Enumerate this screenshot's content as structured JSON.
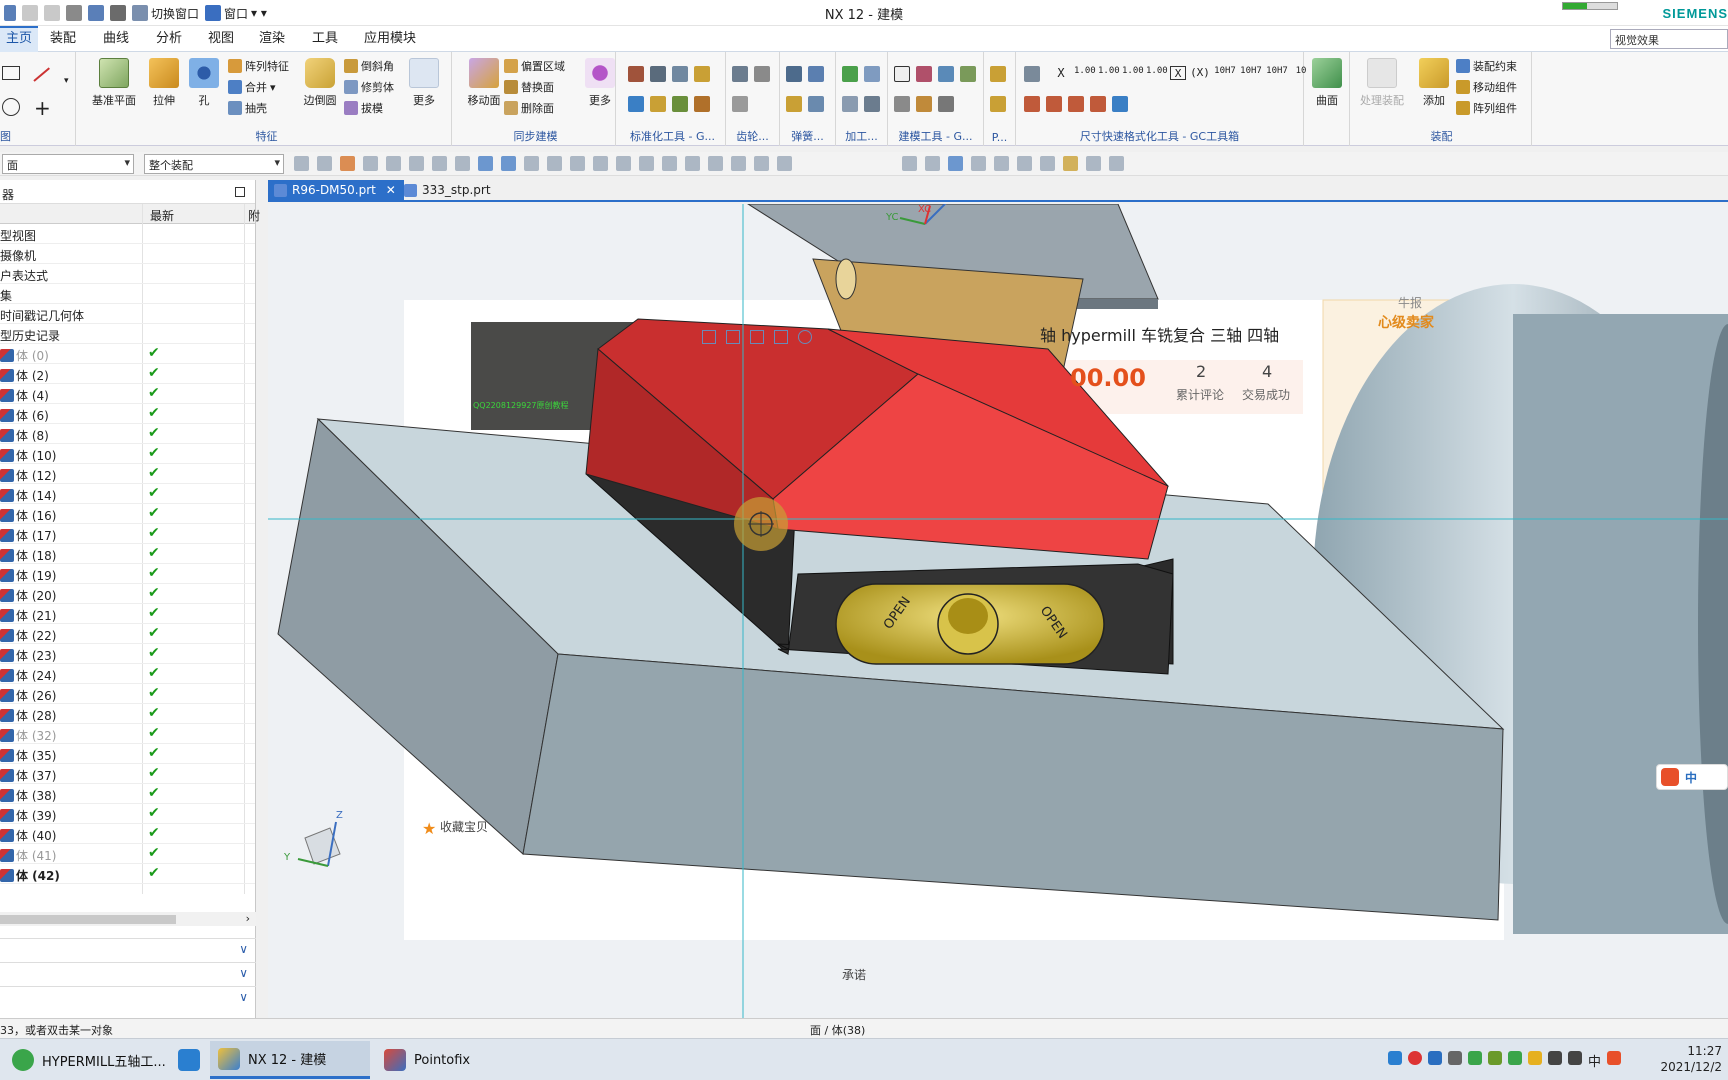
{
  "window": {
    "title": "NX 12 - 建模",
    "brand": "SIEMENS",
    "progress": 0.45
  },
  "quick_access": {
    "switch_window": "切换窗口",
    "window_menu": "窗口"
  },
  "menu": {
    "tabs": [
      "主页",
      "装配",
      "曲线",
      "分析",
      "视图",
      "渲染",
      "工具",
      "应用模块"
    ],
    "active_index": 0,
    "search_value": "视觉效果"
  },
  "ribbon": {
    "sketch_group_title": "图",
    "feature": {
      "title": "特征",
      "datum_plane": "基准平面",
      "extrude": "拉伸",
      "hole": "孔",
      "pattern_feature": "阵列特征",
      "unite": "合并",
      "shell": "抽壳",
      "edge_blend": "边倒圆",
      "chamfer": "倒斜角",
      "trim_body": "修剪体",
      "draft": "拔模",
      "more": "更多"
    },
    "sync": {
      "title": "同步建模",
      "move_face": "移动面",
      "offset_region": "偏置区域",
      "replace_face": "替换面",
      "delete_face": "删除面",
      "more": "更多"
    },
    "gc": {
      "standard_tools": "标准化工具 - G...",
      "gear": "齿轮...",
      "spring": "弹簧...",
      "machining": "加工...",
      "modeling_tools": "建模工具 - G...",
      "p": "P...",
      "dimension_tools": "尺寸快速格式化工具 - GC工具箱"
    },
    "dimension_labels": [
      "X",
      "1.00",
      "1.00",
      "1.00",
      "1.00",
      "(X)",
      "10H7",
      "10H7",
      "10H7",
      "10"
    ],
    "surface": {
      "label": "曲面"
    },
    "assembly": {
      "title": "装配",
      "process_assembly": "处理装配",
      "add": "添加",
      "constraint": "装配约束",
      "move_component": "移动组件",
      "pattern_component": "阵列组件"
    }
  },
  "filter_bar": {
    "type_filter": "面",
    "scope_filter": "整个装配"
  },
  "navigator": {
    "title": "器",
    "col_name": "",
    "col_latest": "最新",
    "col_extra": "附",
    "nodes": [
      {
        "label": "型视图",
        "check": "",
        "state": ""
      },
      {
        "label": "摄像机",
        "check": "",
        "state": ""
      },
      {
        "label": "户表达式",
        "check": "",
        "state": ""
      },
      {
        "label": "集",
        "check": "",
        "state": ""
      },
      {
        "label": "时间戳记几何体",
        "check": "",
        "state": ""
      },
      {
        "label": "型历史记录",
        "check": "",
        "state": ""
      },
      {
        "label": "体 (0)",
        "check": "✔",
        "state": "dim"
      },
      {
        "label": "体 (2)",
        "check": "✔",
        "state": ""
      },
      {
        "label": "体 (4)",
        "check": "✔",
        "state": ""
      },
      {
        "label": "体 (6)",
        "check": "✔",
        "state": ""
      },
      {
        "label": "体 (8)",
        "check": "✔",
        "state": ""
      },
      {
        "label": "体 (10)",
        "check": "✔",
        "state": ""
      },
      {
        "label": "体 (12)",
        "check": "✔",
        "state": ""
      },
      {
        "label": "体 (14)",
        "check": "✔",
        "state": ""
      },
      {
        "label": "体 (16)",
        "check": "✔",
        "state": ""
      },
      {
        "label": "体 (17)",
        "check": "✔",
        "state": ""
      },
      {
        "label": "体 (18)",
        "check": "✔",
        "state": ""
      },
      {
        "label": "体 (19)",
        "check": "✔",
        "state": ""
      },
      {
        "label": "体 (20)",
        "check": "✔",
        "state": ""
      },
      {
        "label": "体 (21)",
        "check": "✔",
        "state": ""
      },
      {
        "label": "体 (22)",
        "check": "✔",
        "state": ""
      },
      {
        "label": "体 (23)",
        "check": "✔",
        "state": ""
      },
      {
        "label": "体 (24)",
        "check": "✔",
        "state": ""
      },
      {
        "label": "体 (26)",
        "check": "✔",
        "state": ""
      },
      {
        "label": "体 (28)",
        "check": "✔",
        "state": ""
      },
      {
        "label": "体 (32)",
        "check": "✔",
        "state": "dim"
      },
      {
        "label": "体 (35)",
        "check": "✔",
        "state": ""
      },
      {
        "label": "体 (37)",
        "check": "✔",
        "state": ""
      },
      {
        "label": "体 (38)",
        "check": "✔",
        "state": ""
      },
      {
        "label": "体 (39)",
        "check": "✔",
        "state": ""
      },
      {
        "label": "体 (40)",
        "check": "✔",
        "state": ""
      },
      {
        "label": "体 (41)",
        "check": "✔",
        "state": "dim"
      },
      {
        "label": "体 (42)",
        "check": "✔",
        "state": "bold"
      }
    ]
  },
  "file_tabs": [
    {
      "label": "R96-DM50.prt",
      "active": true,
      "close": "✕"
    },
    {
      "label": "333_stp.prt",
      "active": false,
      "close": ""
    }
  ],
  "viewport": {
    "overlay": {
      "counter_label": "牛报",
      "headline": "轴 hypermill 车铣复合 三轴 四轴",
      "price": "00.00",
      "stat1_num": "2",
      "stat1_label": "累计评论",
      "stat2_num": "4",
      "stat2_label": "交易成功",
      "seller_badge": "心级卖家",
      "favorite": "收藏宝贝",
      "promise": "承诺",
      "video_watermark": "QQ2208129927原创教程"
    },
    "axes": {
      "xc": "XC",
      "yc": "YC",
      "z": "Z",
      "y": "Y"
    },
    "engraving_left": "OPEN",
    "engraving_right": "OPEN",
    "ime_badge": "中"
  },
  "status": {
    "left": "33，或者双击某一对象",
    "mid": "面 / 体(38)"
  },
  "taskbar": {
    "tasks": [
      {
        "label": "HYPERMILL五轴工...",
        "active": false
      },
      {
        "label": "",
        "active": false
      },
      {
        "label": "NX 12 - 建模",
        "active": true
      },
      {
        "label": "Pointofix",
        "active": false
      }
    ],
    "ime": "中",
    "time": "11:27",
    "date": "2021/12/2"
  },
  "colors": {
    "accent": "#2c6fc9",
    "part_red": "#e53a3a",
    "part_black": "#2b2b2b",
    "part_tan": "#c9a35e",
    "gold": "#c9b02a",
    "steel": "#8e9ea8",
    "check_green": "#1a9a1a"
  }
}
